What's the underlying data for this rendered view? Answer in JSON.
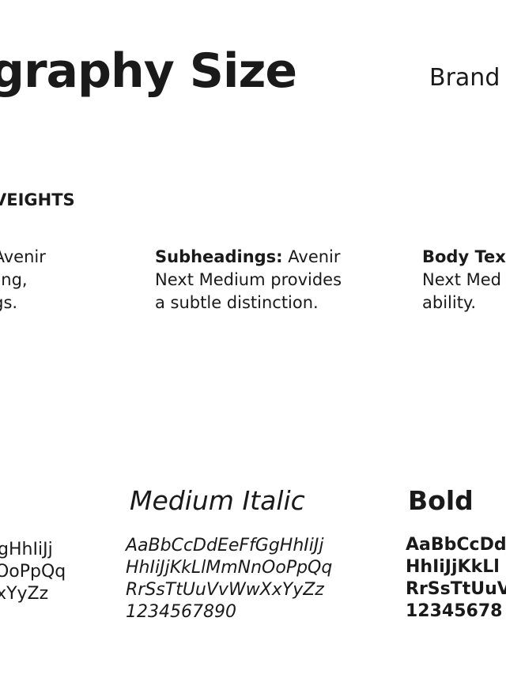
{
  "header": {
    "title": "graphy Size",
    "brand": "Brand"
  },
  "section": {
    "label": "VEIGHTS"
  },
  "descriptions": {
    "left": {
      "line1": "e Avenir",
      "line2": "trong,",
      "line3": "ings."
    },
    "middle": {
      "lead": "Subheadings:",
      "line1_rest": " Avenir",
      "line2": "Next Medium provides",
      "line3": "a subtle distinction."
    },
    "right": {
      "lead": "Body Tex",
      "line2": "Next Med",
      "line3": "ability."
    }
  },
  "styles": {
    "italic_name": "Medium Italic",
    "bold_name": "Bold"
  },
  "specimens": {
    "left": [
      "GgHhIiJj",
      "nOoPpQq",
      "XxYyZz"
    ],
    "middle": [
      "AaBbCcDdEeFfGgHhIiJj",
      "HhIiJjKkLlMmNnOoPpQq",
      "RrSsTtUuVvWwXxYyZz",
      "1234567890"
    ],
    "right": [
      "AaBbCcDd",
      "HhIiJjKkLl",
      "RrSsTtUuV",
      "12345678"
    ]
  }
}
